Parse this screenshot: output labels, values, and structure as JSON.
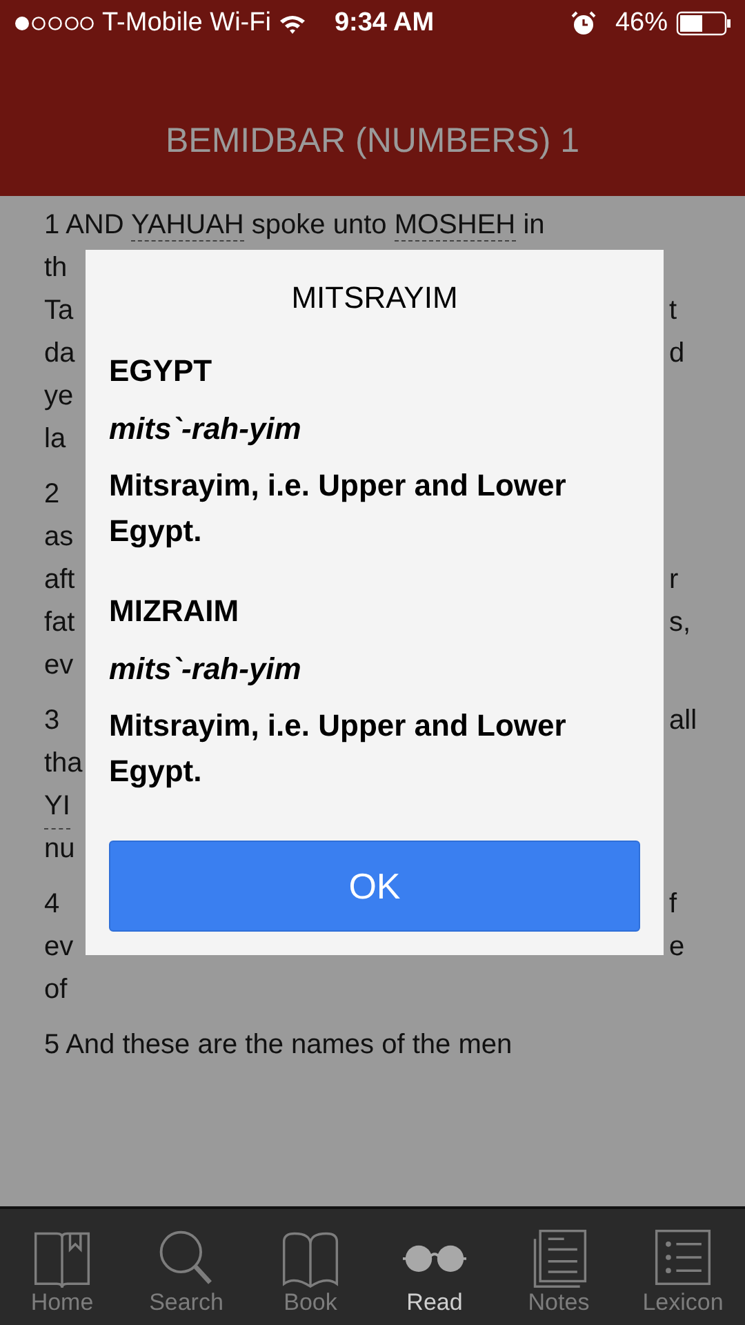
{
  "status_bar": {
    "carrier": "T-Mobile Wi-Fi",
    "time": "9:34 AM",
    "battery": "46%"
  },
  "header": {
    "title": "BEMIDBAR (NUMBERS) 1"
  },
  "verses": [
    {
      "lines": [
        {
          "left": [
            {
              "text": "1 AND ",
              "kind": "plain"
            },
            {
              "text": "YAHUAH",
              "kind": "name"
            },
            {
              "text": " spoke unto ",
              "kind": "plain"
            },
            {
              "text": "MOSHEH",
              "kind": "name"
            },
            {
              "text": " in",
              "kind": "plain"
            }
          ]
        },
        {
          "left": [
            {
              "text": "th",
              "kind": "plain"
            }
          ]
        },
        {
          "left": [
            {
              "text": "Ta",
              "kind": "plain"
            }
          ],
          "right": "t"
        },
        {
          "left": [
            {
              "text": "da",
              "kind": "plain"
            }
          ],
          "right": "d"
        },
        {
          "left": [
            {
              "text": "ye",
              "kind": "plain"
            }
          ]
        },
        {
          "left": [
            {
              "text": "la",
              "kind": "plain"
            }
          ]
        }
      ]
    },
    {
      "lines": [
        {
          "left": [
            {
              "text": "2",
              "kind": "plain"
            }
          ]
        },
        {
          "left": [
            {
              "text": "as",
              "kind": "plain"
            }
          ]
        },
        {
          "left": [
            {
              "text": "aft",
              "kind": "plain"
            }
          ],
          "right": "r"
        },
        {
          "left": [
            {
              "text": "fat",
              "kind": "plain"
            }
          ],
          "right": "s,"
        },
        {
          "left": [
            {
              "text": "ev",
              "kind": "plain"
            }
          ]
        }
      ]
    },
    {
      "lines": [
        {
          "left": [
            {
              "text": "3",
              "kind": "plain"
            }
          ],
          "right": "all"
        },
        {
          "left": [
            {
              "text": "tha",
              "kind": "plain"
            }
          ]
        },
        {
          "left": [
            {
              "text": "YI",
              "kind": "name"
            }
          ]
        },
        {
          "left": [
            {
              "text": "nu",
              "kind": "plain"
            }
          ]
        }
      ]
    },
    {
      "lines": [
        {
          "left": [
            {
              "text": "4",
              "kind": "plain"
            }
          ],
          "right": "f"
        },
        {
          "left": [
            {
              "text": "ev",
              "kind": "plain"
            }
          ],
          "right": "e"
        },
        {
          "left": [
            {
              "text": "of",
              "kind": "plain"
            }
          ]
        }
      ]
    },
    {
      "lines": [
        {
          "left": [
            {
              "text": "5 And these are the names of the men",
              "kind": "plain"
            }
          ]
        }
      ]
    }
  ],
  "dialog": {
    "title": "MITSRAYIM",
    "entries": [
      {
        "heading": "EGYPT",
        "pronunciation": "mits`-rah-yim",
        "definition": "Mitsrayim, i.e. Upper and Lower Egypt."
      },
      {
        "heading": "MIZRAIM",
        "pronunciation": "mits`-rah-yim",
        "definition": "Mitsrayim, i.e. Upper and Lower Egypt."
      }
    ],
    "button": "OK"
  },
  "tabs": [
    {
      "label": "Home",
      "selected": false
    },
    {
      "label": "Search",
      "selected": false
    },
    {
      "label": "Book",
      "selected": false
    },
    {
      "label": "Read",
      "selected": true
    },
    {
      "label": "Notes",
      "selected": false
    },
    {
      "label": "Lexicon",
      "selected": false
    }
  ]
}
